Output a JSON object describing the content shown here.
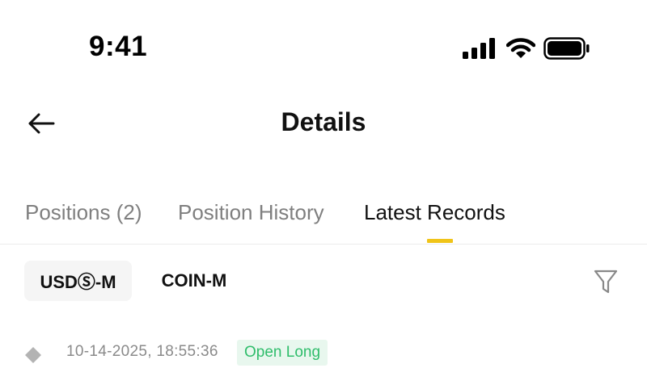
{
  "status_bar": {
    "time": "9:41",
    "icons": [
      "cellular-signal-icon",
      "wifi-icon",
      "battery-icon"
    ]
  },
  "header": {
    "back_icon": "arrow-left-icon",
    "title": "Details"
  },
  "tabs": [
    {
      "label": "Positions (2)",
      "active": false
    },
    {
      "label": "Position History",
      "active": false
    },
    {
      "label": "Latest Records",
      "active": true
    }
  ],
  "segments": [
    {
      "label": "USDⓈ-M",
      "selected": true
    },
    {
      "label": "COIN-M",
      "selected": false
    }
  ],
  "filter": {
    "icon": "funnel-filter-icon"
  },
  "records": [
    {
      "icon": "diamond-icon",
      "timestamp": "10-14-2025, 18:55:36",
      "action": "Open Long"
    }
  ],
  "colors": {
    "accent_yellow": "#f0c419",
    "tab_inactive": "#7f7f7f",
    "positive_green": "#2fbd6b",
    "positive_green_bg": "#e8f7ee",
    "segment_selected_bg": "#f5f5f5"
  }
}
